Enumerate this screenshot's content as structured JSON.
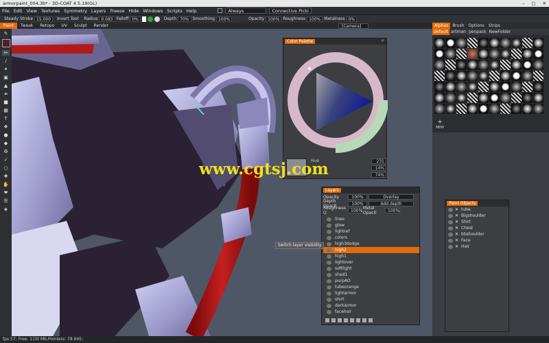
{
  "window": {
    "title": "armorpaint_004.3b* - 3D-COAT 4.5.19(GL)"
  },
  "menu": [
    "File",
    "Edit",
    "View",
    "Textures",
    "Symmetry",
    "Layers",
    "Freeze",
    "Hide",
    "Windows",
    "Scripts",
    "Help"
  ],
  "menu_right": {
    "always": "Always",
    "connective": "Connective Picki"
  },
  "toolbar": {
    "steady": "Steady",
    "stroke_label": "Stroke",
    "stroke_value": "15.000",
    "invert": "Invert",
    "tool": "Tool",
    "radius_label": "Radius",
    "radius_value": "0.083",
    "falloff_label": "Falloff",
    "falloff_value": "0%",
    "depth_label": "Depth",
    "depth_value": "70%",
    "smoothing_label": "Smoothing",
    "smoothing_value": "100%",
    "opacity_label": "Opacity",
    "opacity_value": "100%",
    "roughness_label": "Roughness",
    "roughness_value": "100%",
    "metalness_label": "Metalness",
    "metalness_value": "0%"
  },
  "room_tabs": [
    "Paint",
    "Tweak",
    "Retopo",
    "UV",
    "Sculpt",
    "Render"
  ],
  "camera": "[Camera]",
  "color_palette": {
    "title": "Color Palette",
    "hue_label": "Hue",
    "hue_value": "231",
    "sat_value": "14%",
    "val_value": "74%"
  },
  "watermark": "www.cgtsj.com",
  "layers_panel": {
    "title": "Layers",
    "opacity_label": "Opacity",
    "opacity_value": "100%",
    "blend_mode": "Overlay",
    "depth_opacity_label": "Depth Opacit",
    "depth_opacity_value": "100%",
    "add_depth": "Add depth",
    "roughness_label": "Roughness O",
    "roughness_value": "100%",
    "metal_label": "Metal Opacit",
    "metal_value": "100%",
    "items": [
      "lines",
      "glow",
      "lightref",
      "colors",
      "high3dodge",
      "high2",
      "high1",
      "lightover",
      "softlight",
      "shad1",
      "purpAO",
      "tubeorange",
      "lightarmor",
      "shirt",
      "darkarmor",
      "facehair"
    ],
    "selected": "high2"
  },
  "tooltip": "Switch layer visibility",
  "alphas_panel": {
    "tabs": [
      "Alphas",
      "Brush",
      "Options",
      "Strips"
    ],
    "subtabs": [
      "default",
      "artman",
      "penpack",
      "NewFolder"
    ],
    "new_label": "NEW"
  },
  "paint_objects": {
    "title": "Paint Objects",
    "items": [
      "tube",
      "Bigshoulder",
      "Shirt",
      "Chest",
      "bbshoulder",
      "Face",
      "Hair"
    ]
  },
  "status": "fps:57;   Free: 115t Mb,Pointers: 78 645;",
  "colors": {
    "accent": "#e36c0a",
    "red": "#b51a1a",
    "armor": "#9a97c8"
  }
}
